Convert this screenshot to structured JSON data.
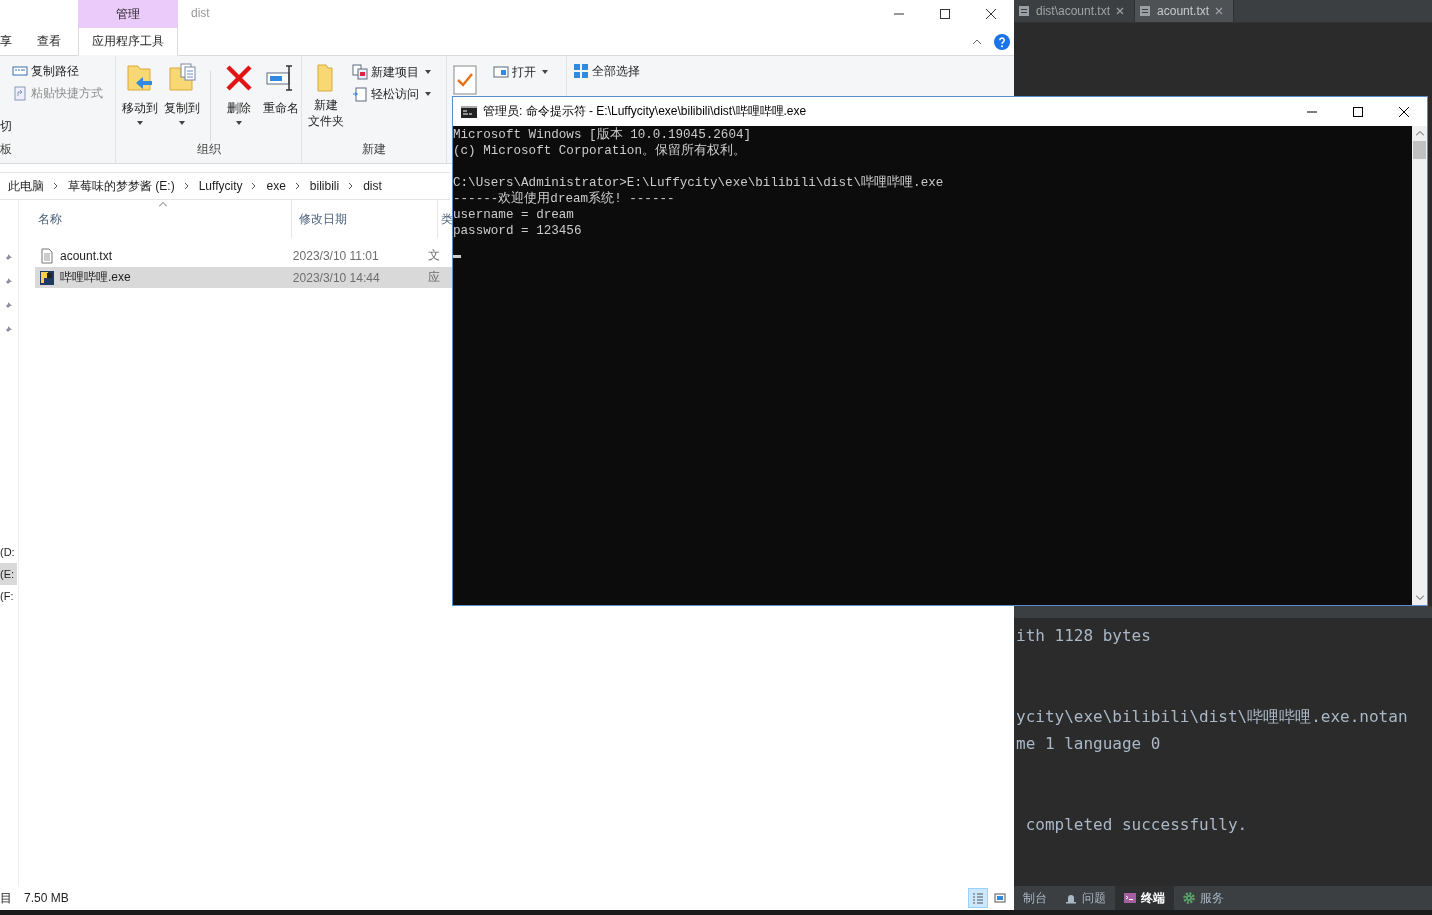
{
  "ide": {
    "tabs": [
      {
        "label": "dist\\acount.txt",
        "selected": false
      },
      {
        "label": "acount.txt",
        "selected": true
      }
    ],
    "terminal_blocks": [
      [
        "ith 1128 bytes"
      ],
      [
        "ycity\\exe\\bilibili\\dist\\哔哩哔哩.exe.notan",
        "me 1 language 0"
      ],
      [
        " completed successfully."
      ]
    ],
    "tool_tabs": [
      {
        "label": "制台",
        "kind": "console",
        "selected": false
      },
      {
        "label": "问题",
        "kind": "problems",
        "selected": false
      },
      {
        "label": "终端",
        "kind": "terminal",
        "selected": true
      },
      {
        "label": "服务",
        "kind": "services",
        "selected": false
      }
    ]
  },
  "explorer": {
    "context_tab": "管理",
    "title": "dist",
    "tabs": [
      {
        "label": "享",
        "selected": false
      },
      {
        "label": "查看",
        "selected": false
      },
      {
        "label": "应用程序工具",
        "selected": true
      }
    ],
    "ribbon": {
      "clipboard": {
        "items": [
          {
            "label": "复制路径",
            "disabled": false
          },
          {
            "label": "粘贴快捷方式",
            "disabled": true
          }
        ],
        "cut_label": "切",
        "group_label": "板"
      },
      "organize": {
        "buttons": [
          {
            "label": "移动到",
            "kind": "move",
            "dropdown": true
          },
          {
            "label": "复制到",
            "kind": "copy",
            "dropdown": true
          },
          {
            "label": "删除",
            "kind": "delete",
            "dropdown": true
          },
          {
            "label": "重命名",
            "kind": "rename",
            "dropdown": false
          }
        ],
        "group_label": "组织"
      },
      "new": {
        "folder_label": [
          "新建",
          "文件夹"
        ],
        "items": [
          {
            "label": "新建项目",
            "kind": "new-item"
          },
          {
            "label": "轻松访问",
            "kind": "easy-access"
          }
        ],
        "group_label": "新建"
      },
      "open": {
        "items": [
          "打开"
        ]
      },
      "select": {
        "items": [
          {
            "label": "全部选择",
            "kind": "all"
          }
        ]
      }
    },
    "breadcrumb": [
      "此电脑",
      "草莓味的梦梦酱 (E:)",
      "Luffycity",
      "exe",
      "bilibili",
      "dist"
    ],
    "nav": [
      {
        "label": "(D:",
        "selected": false
      },
      {
        "label": "(E:",
        "selected": true
      },
      {
        "label": "(F:",
        "selected": false
      }
    ],
    "columns": [
      "名称",
      "修改日期",
      "类"
    ],
    "files": [
      {
        "name": "acount.txt",
        "date": "2023/3/10 11:01",
        "type": "文",
        "kind": "text",
        "selected": false
      },
      {
        "name": "哔哩哔哩.exe",
        "date": "2023/3/10 14:44",
        "type": "应",
        "kind": "exe",
        "selected": true
      }
    ],
    "status": {
      "items": "目",
      "size": "7.50 MB"
    },
    "views": [
      {
        "kind": "details",
        "selected": true
      },
      {
        "kind": "large",
        "selected": false
      }
    ]
  },
  "cmd": {
    "title": "管理员: 命令提示符 - E:\\Luffycity\\exe\\bilibili\\dist\\哔哩哔哩.exe",
    "blocks": [
      [
        "Microsoft Windows [版本 10.0.19045.2604]",
        "(c) Microsoft Corporation。保留所有权利。"
      ],
      [
        "C:\\Users\\Administrator>E:\\Luffycity\\exe\\bilibili\\dist\\哔哩哔哩.exe",
        "------欢迎使用dream系统! ------",
        "username = dream",
        "password = 123456"
      ]
    ]
  }
}
